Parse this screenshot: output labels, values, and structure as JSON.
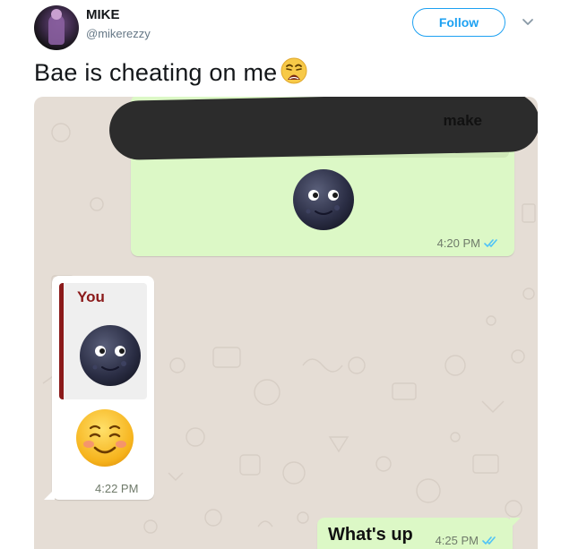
{
  "tweet": {
    "author_name": "MIKE",
    "author_handle": "@mikerezzy",
    "follow_label": "Follow",
    "text": "Bae is cheating on me"
  },
  "chat": {
    "messages": [
      {
        "type": "outgoing",
        "quoted_fragment": "make",
        "emoji": "new-moon-face",
        "time": "4:20 PM",
        "status": "read-double-tick"
      },
      {
        "type": "incoming",
        "quoted_author": "You",
        "quoted_emoji": "new-moon-face",
        "emoji": "smiling-face",
        "time": "4:22 PM"
      },
      {
        "type": "outgoing",
        "text": "What's up",
        "time": "4:25 PM",
        "status": "read-double-tick"
      }
    ]
  },
  "colors": {
    "follow_blue": "#1da1f2",
    "chat_background": "#e5ddd5",
    "outgoing_bubble": "#dcf8c6",
    "incoming_bubble": "#ffffff",
    "quote_accent": "#8b1a1a",
    "read_tick": "#4fc3f7"
  }
}
